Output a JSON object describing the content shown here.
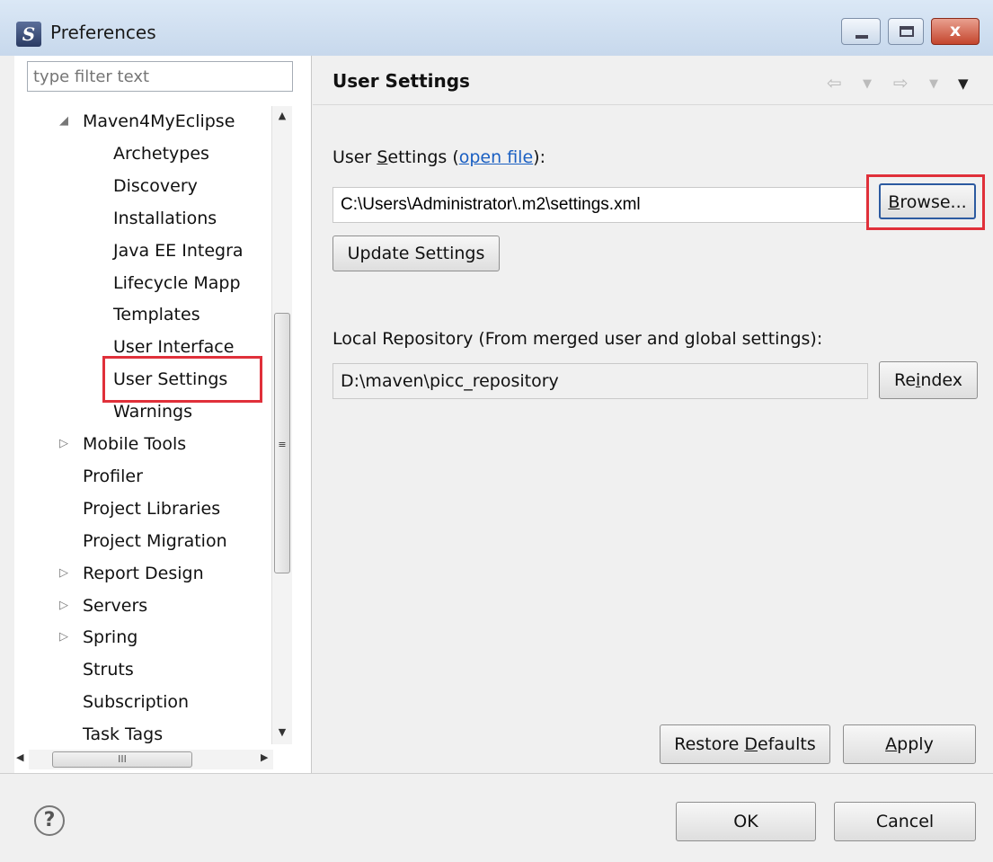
{
  "window": {
    "title": "Preferences",
    "close_glyph": "x"
  },
  "left": {
    "filter_placeholder": "type filter text",
    "tree": [
      {
        "label": "Maven4MyEclipse",
        "arrow": "◢",
        "level": 0
      },
      {
        "label": "Archetypes",
        "arrow": "",
        "level": 1
      },
      {
        "label": "Discovery",
        "arrow": "",
        "level": 1
      },
      {
        "label": "Installations",
        "arrow": "",
        "level": 1
      },
      {
        "label": "Java EE Integra",
        "arrow": "",
        "level": 1
      },
      {
        "label": "Lifecycle Mapp",
        "arrow": "",
        "level": 1
      },
      {
        "label": "Templates",
        "arrow": "",
        "level": 1
      },
      {
        "label": "User Interface",
        "arrow": "",
        "level": 1
      },
      {
        "label": "User Settings",
        "arrow": "",
        "level": 1
      },
      {
        "label": "Warnings",
        "arrow": "",
        "level": 1
      },
      {
        "label": "Mobile Tools",
        "arrow": "▷",
        "level": 0
      },
      {
        "label": "Profiler",
        "arrow": "",
        "level": 0
      },
      {
        "label": "Project Libraries",
        "arrow": "",
        "level": 0
      },
      {
        "label": "Project Migration",
        "arrow": "",
        "level": 0
      },
      {
        "label": "Report Design",
        "arrow": "▷",
        "level": 0
      },
      {
        "label": "Servers",
        "arrow": "▷",
        "level": 0
      },
      {
        "label": "Spring",
        "arrow": "▷",
        "level": 0
      },
      {
        "label": "Struts",
        "arrow": "",
        "level": 0
      },
      {
        "label": "Subscription",
        "arrow": "",
        "level": 0
      },
      {
        "label": "Task Tags",
        "arrow": "",
        "level": 0
      }
    ],
    "hscroll_grip": "III"
  },
  "right": {
    "page_title": "User Settings",
    "user_settings_label_pre": "User ",
    "user_settings_label_mnemonic": "S",
    "user_settings_label_post": "ettings (",
    "open_file_link": "open file",
    "user_settings_label_end": "):",
    "user_settings_path": "C:\\Users\\Administrator\\.m2\\settings.xml",
    "browse_mnemonic": "B",
    "browse_rest": "rowse...",
    "update_settings": "Update Settings",
    "local_repo_label": "Local Repository (From merged user and global settings):",
    "local_repo_path": "D:\\maven\\picc_repository",
    "reindex_pre": "Re",
    "reindex_mnemonic": "i",
    "reindex_post": "ndex",
    "restore_pre": "Restore ",
    "restore_mnemonic": "D",
    "restore_post": "efaults",
    "apply_mnemonic": "A",
    "apply_rest": "pply"
  },
  "footer": {
    "help_glyph": "?",
    "ok": "OK",
    "cancel": "Cancel"
  },
  "colors": {
    "highlight_box": "#e0303a",
    "link": "#1a5fc2"
  }
}
